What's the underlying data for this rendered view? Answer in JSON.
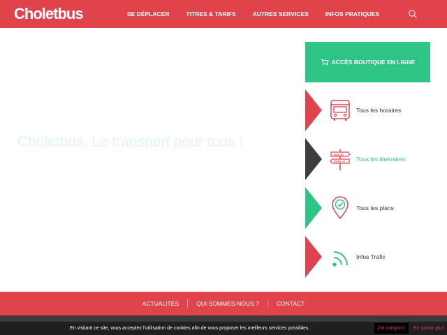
{
  "brand": {
    "logo": "Choletbus",
    "primary_color": "#e0434c",
    "accent_green": "#2ec486"
  },
  "nav": {
    "items": [
      {
        "label": "SE DÉPLACER"
      },
      {
        "label": "TITRES & TARIFS"
      },
      {
        "label": "AUTRES SERVICES"
      },
      {
        "label": "INFOS PRATIQUES"
      }
    ],
    "search_icon": "search-icon"
  },
  "hero": {
    "tagline": "Choletbus, Le transport pour tous !"
  },
  "shop": {
    "label": "ACCÈS BOUTIQUE EN LIGNE",
    "icon": "cart-icon"
  },
  "tiles": [
    {
      "label": "Tous les horaires",
      "icon": "bus-icon",
      "color": "#e0434c",
      "label_color": "#333333"
    },
    {
      "label": "Tous les itinéraires",
      "icon": "signpost-icon",
      "color": "#3d3d3d",
      "label_color": "#2ec486",
      "sign_top": "CHOLET",
      "sign_bottom": "NUAILLE"
    },
    {
      "label": "Tous les plans",
      "icon": "map-pin-icon",
      "color": "#2ec486",
      "label_color": "#333333"
    },
    {
      "label": "Infos Trafic",
      "icon": "signal-icon",
      "color": "#e0434c",
      "label_color": "#333333"
    }
  ],
  "footer": {
    "links": [
      {
        "label": "ACTUALITÉS"
      },
      {
        "label": "QUI SOMMES-NOUS ?"
      },
      {
        "label": "CONTACT"
      }
    ]
  },
  "cookie": {
    "text": "En visitant ce site, vous acceptez l'utilisation de cookies afin de vous proposer les meilleurs services possibles.",
    "accept": "J'ai compris !",
    "more": "En savoir plus"
  }
}
